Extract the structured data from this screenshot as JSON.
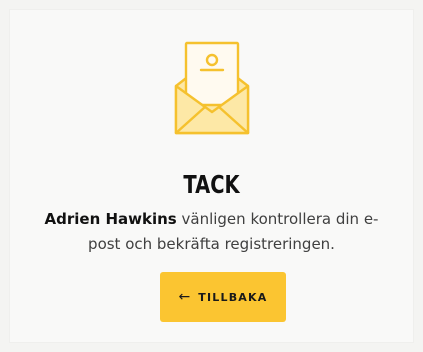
{
  "confirmation": {
    "title": "TACK",
    "user_name": "Adrien Hawkins",
    "message_line1_rest": " vänligen kontrollera din e-",
    "message_line2": "post och bekräfta registreringen."
  },
  "back_button": {
    "icon": "arrow-left-icon",
    "label": "TILLBAKA"
  },
  "colors": {
    "accent": "#fbc531",
    "envelope_fill": "#fde8a6",
    "envelope_stroke": "#f5c12e",
    "title": "#111111",
    "body_text": "#404040"
  }
}
